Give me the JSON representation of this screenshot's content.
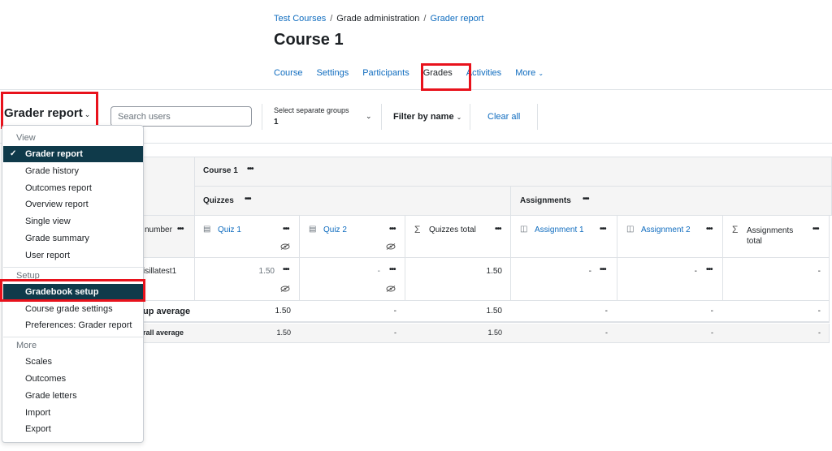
{
  "breadcrumb": [
    "Test Courses",
    "Grade administration",
    "Grader report"
  ],
  "page_title": "Course 1",
  "secondary_nav": {
    "tabs": [
      "Course",
      "Settings",
      "Participants",
      "Grades",
      "Activities"
    ],
    "more": "More"
  },
  "toolbar": {
    "report_selector": "Grader report",
    "search_placeholder": "Search users",
    "group_label": "Select separate groups",
    "group_value": "1",
    "filter_by_name": "Filter by name",
    "clear_all": "Clear all"
  },
  "table": {
    "course_header": "Course 1",
    "category_quizzes": "Quizzes",
    "category_assignments": "Assignments",
    "id_column": "number",
    "columns": [
      "Quiz 1",
      "Quiz 2",
      "Quizzes total",
      "Assignment 1",
      "Assignment 2",
      "Assignments total"
    ],
    "student_name": "isillatest1",
    "student_row": [
      "1.50",
      "-",
      "1.50",
      "-",
      "-",
      "-"
    ],
    "group_average_label": "up average",
    "group_average": [
      "1.50",
      "-",
      "1.50",
      "-",
      "-",
      "-"
    ],
    "overall_average_label": "rall average",
    "overall_average": [
      "1.50",
      "-",
      "1.50",
      "-",
      "-",
      "-"
    ]
  },
  "dropdown": {
    "view_heading": "View",
    "view_items": [
      "Grader report",
      "Grade history",
      "Outcomes report",
      "Overview report",
      "Single view",
      "Grade summary",
      "User report"
    ],
    "setup_heading": "Setup",
    "setup_items": [
      "Gradebook setup",
      "Course grade settings",
      "Preferences: Grader report"
    ],
    "more_heading": "More",
    "more_items": [
      "Scales",
      "Outcomes",
      "Grade letters",
      "Import",
      "Export"
    ]
  },
  "colors": {
    "link": "#0f6cbf",
    "active_item": "#0f3a4a",
    "highlight_border": "#e8121c"
  }
}
